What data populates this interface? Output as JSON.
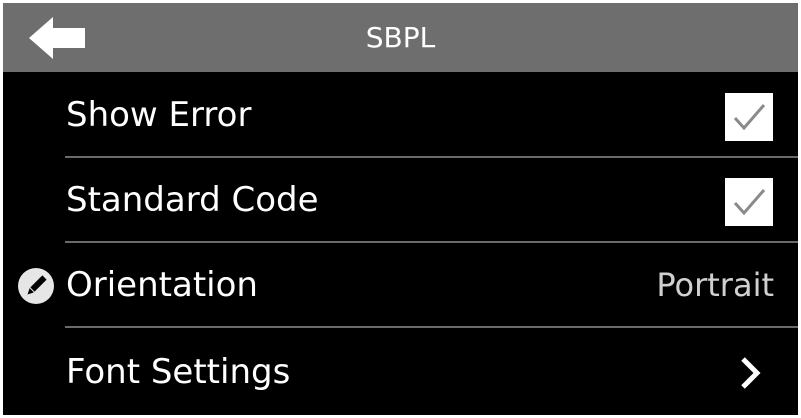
{
  "header": {
    "title": "SBPL",
    "back_icon": "back-arrow-icon"
  },
  "settings": {
    "items": [
      {
        "label": "Show Error",
        "control": "checkbox",
        "checked": true,
        "icon": "check-icon"
      },
      {
        "label": "Standard Code",
        "control": "checkbox",
        "checked": true,
        "icon": "check-icon"
      },
      {
        "label": "Orientation",
        "control": "value",
        "value": "Portrait",
        "leading_icon": "pencil-icon"
      },
      {
        "label": "Font Settings",
        "control": "navigate",
        "icon": "chevron-right-icon"
      }
    ]
  },
  "colors": {
    "background": "#000000",
    "title_bar": "#6e6e6e",
    "text": "#ffffff",
    "value_text": "#d0d0d0",
    "divider": "#6a6a6a",
    "checkmark": "#8a8a8a"
  }
}
